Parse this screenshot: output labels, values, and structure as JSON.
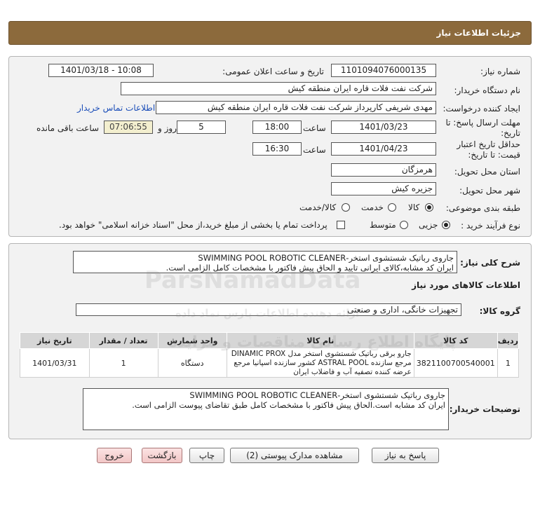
{
  "header": {
    "title": "جزئیات اطلاعات نیاز"
  },
  "fields": {
    "need_number_label": "شماره نیاز:",
    "need_number": "1101094076000135",
    "announce_label": "تاریخ و ساعت اعلان عمومی:",
    "announce_value": "1401/03/18 - 10:08",
    "buyer_org_label": "نام دستگاه خریدار:",
    "buyer_org": "شرکت نفت فلات قاره ایران منطقه کیش",
    "requester_label": "ایجاد کننده درخواست:",
    "requester": "مهدی شریفی کارپرداز شرکت نفت فلات قاره ایران منطقه کیش",
    "contact_link": "اطلاعات تماس خریدار",
    "reply_deadline_label": "مهلت ارسال پاسخ: تا تاریخ:",
    "reply_date": "1401/03/23",
    "time_label": "ساعت",
    "reply_time": "18:00",
    "days_value": "5",
    "days_label": "روز و",
    "remaining_time": "07:06:55",
    "remaining_label": "ساعت باقی مانده",
    "validity_label": "حداقل تاریخ اعتبار قیمت: تا تاریخ:",
    "validity_date": "1401/04/23",
    "validity_time_label": "ساعت",
    "validity_time": "16:30",
    "province_label": "استان محل تحویل:",
    "province": "هرمزگان",
    "city_label": "شهر محل تحویل:",
    "city": "جزیره کیش",
    "category_label": "طبقه بندی موضوعی:",
    "category_options": [
      "کالا",
      "خدمت",
      "کالا/خدمت"
    ],
    "process_label": "نوع فرآیند خرید :",
    "process_options": [
      "جزیی",
      "متوسط"
    ],
    "payment_note": "پرداخت تمام یا بخشی از مبلغ خرید،از محل \"اسناد خزانه اسلامی\" خواهد بود."
  },
  "summary": {
    "label": "شرح کلی نیاز:",
    "line1": "جاروی رباتیک شستشوی استخر-SWIMMING POOL ROBOTIC CLEANER",
    "line2": "ایران کد مشابه،کالای ایرانی تایید و الحاق پیش فاکتور با مشخصات کامل الزامی است."
  },
  "goods_section": {
    "title": "اطلاعات کالاهای مورد نیاز",
    "group_label": "گروه کالا:",
    "group_value": "تجهیزات خانگی، اداری و صنعتی"
  },
  "table": {
    "headers": [
      "ردیف",
      "کد کالا",
      "نام کالا",
      "واحد شمارش",
      "تعداد / مقدار",
      "تاریخ نیاز"
    ],
    "rows": [
      {
        "row": "1",
        "code": "3821100700540001",
        "name_lines": [
          "جارو برقی رباتیک شستشوی استخر مدل DINAMIC PROX",
          "مرجع سازنده ASTRAL POOL کشور سازنده اسپانیا مرجع",
          "عرضه کننده تصفیه آب و فاضلاب ایران"
        ],
        "unit": "دستگاه",
        "qty": "1",
        "date": "1401/03/31"
      }
    ]
  },
  "buyer_notes": {
    "label": "توضیحات خریدار:",
    "line1": "جاروی رباتیک شستشوی استخر-SWIMMING POOL ROBOTIC CLEANER",
    "line2": "ایران کد مشابه است.الحاق پیش فاکتور با مشخصات کامل طبق تقاضای پیوست الزامی است."
  },
  "buttons": {
    "reply": "پاسخ به نیاز",
    "attachments": "مشاهده مدارک پیوستی (2)",
    "print": "چاپ",
    "back": "بازگشت",
    "exit": "خروج"
  },
  "watermark": {
    "brand": "ParsNamadData",
    "line1": "پایگاه اطلاع رسانی مناقصات و مزایده",
    "line2": "ارائه دهنده اطلاعات پارس نماد داده"
  },
  "colors": {
    "header": "#8c6a3c",
    "panel": "#f2f2f2",
    "link": "#1a4db8",
    "time_box": "#f3efcf"
  }
}
